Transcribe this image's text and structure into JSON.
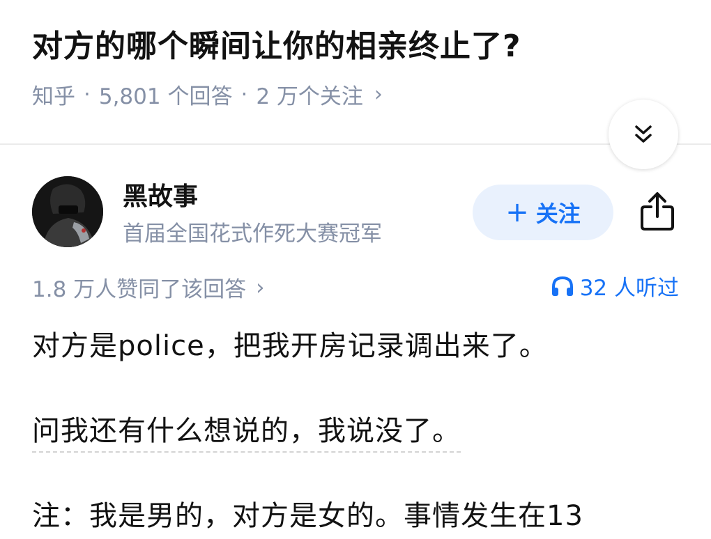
{
  "question": {
    "title": "对方的哪个瞬间让你的相亲终止了?",
    "source": "知乎",
    "separator": "·",
    "answers": "5,801 个回答",
    "followers": "2 万个关注",
    "chevron": "›"
  },
  "collapse": {
    "icon": "double-chevron-down-icon"
  },
  "answer": {
    "author": {
      "name": "黑故事",
      "bio": "首届全国花式作死大赛冠军"
    },
    "follow": {
      "plus": "+",
      "label": "关注"
    },
    "share": {
      "icon": "share-icon"
    },
    "upvotes": "1.8 万人赞同了该回答",
    "upvotes_chevron": "›",
    "listens": "32 人听过",
    "paragraphs": [
      "对方是police，把我开房记录调出来了。",
      "问我还有什么想说的，我说没了。",
      "注：我是男的，对方是女的。事情发生在13"
    ]
  },
  "colors": {
    "accent": "#1772f6",
    "follow_bg": "#e9f1fd",
    "muted": "#8590a6",
    "text": "#121212"
  }
}
